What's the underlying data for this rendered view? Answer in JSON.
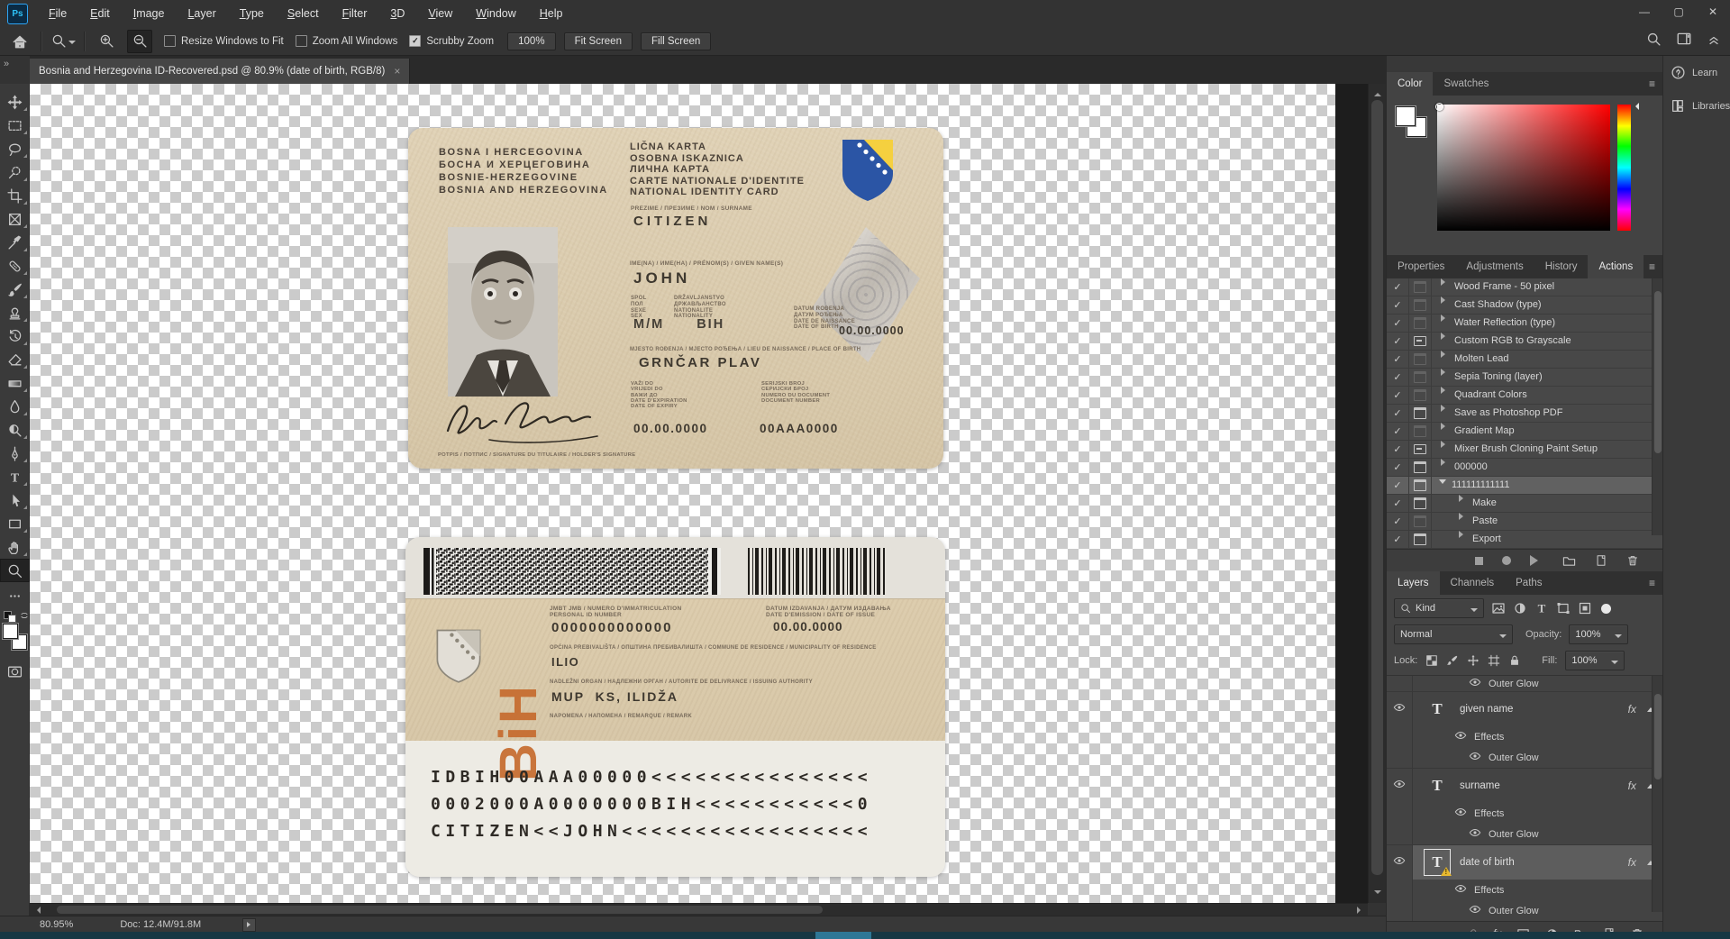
{
  "window": {
    "logo": "Ps",
    "menus": [
      "File",
      "Edit",
      "Image",
      "Layer",
      "Type",
      "Select",
      "Filter",
      "3D",
      "View",
      "Window",
      "Help"
    ],
    "controls": {
      "minimize": "—",
      "restore": "▢",
      "close": "✕"
    }
  },
  "options": {
    "resize_windows": "Resize Windows to Fit",
    "zoom_all_windows": "Zoom All Windows",
    "scrubby_zoom": "Scrubby Zoom",
    "zoom_level": "100%",
    "fit_screen": "Fit Screen",
    "fill_screen": "Fill Screen"
  },
  "tab": {
    "title": "Bosnia and Herzegovina ID-Recovered.psd @ 80.9% (date of birth, RGB/8)",
    "close": "×",
    "overflow": "»"
  },
  "front": {
    "country": [
      "BOSNA I HERCEGOVINA",
      "БОСНА И ХЕРЦЕГОВИНА",
      "BOSNIE-HERZEGOVINE",
      "BOSNIA AND HERZEGOVINA"
    ],
    "card_titles": [
      "LIČNA KARTA",
      "OSOBNA ISKAZNICA",
      "ЛИЧНА КАРТА",
      "CARTE NATIONALE D'IDENTITE",
      "NATIONAL IDENTITY CARD"
    ],
    "surname_label": "PREZIME / ПРЕЗИМЕ / NOM / SURNAME",
    "surname": "CITIZEN",
    "given_label": "IME(NA) / ИМЕ(НА) / PRÉNOM(S) / GIVEN NAME(S)",
    "given": "JOHN",
    "sex_labels": [
      "SPOL",
      "ПОЛ",
      "SEXE",
      "SEX"
    ],
    "nat_labels": [
      "DRŽAVLJANSTVO",
      "ДРЖАВЉАНСТВО",
      "NATIONALITE",
      "NATIONALITY"
    ],
    "dob_labels": [
      "DATUM ROĐENJA",
      "ДАТУМ РОЂЕЊА",
      "DATE DE NAISSANCE",
      "DATE OF BIRTH"
    ],
    "sex_value": "M/M",
    "nat_value": "BIH",
    "dob_value": "00.00.0000",
    "pob_label": "MJESTO ROĐENJA / МЈЕСТО РОЂЕЊА / LIEU DE NAISSANCE / PLACE OF BIRTH",
    "pob_value": "GRNČAR PLAV",
    "expiry_labels": [
      "VAŽI DO",
      "VRIJEDI DO",
      "ВАЖИ ДО",
      "DATE D'EXPIRATION",
      "DATE OF EXPIRY"
    ],
    "docnum_labels": [
      "SERIJSKI BROJ",
      "СЕРИЈСКИ БРОЈ",
      "NUMERO DU DOCUMENT",
      "DOCUMENT NUMBER"
    ],
    "expiry_value": "00.00.0000",
    "docnum_value": "00AAA0000",
    "signature_label": "POTPIS / ПОТПИС / SIGNATURE DU TITULAIRE / HOLDER'S SIGNATURE"
  },
  "back": {
    "pin_label1": "JMBT JMB / NUMERO D'IMMATRICULATION",
    "pin_label2": "PERSONAL ID NUMBER",
    "pin": "0000000000000",
    "issue_label1": "DATUM IZDAVANJA / ДАТУМ ИЗДАВАЊА",
    "issue_label2": "DATE D'EMISSION / DATE OF ISSUE",
    "issue": "00.00.0000",
    "residence_label": "OPĆINA PREBIVALIŠTA / ОПШТИНА ПРЕБИВАЛИШТА / COMMUNE DE RESIDENCE / MUNICIPALITY OF RESIDENCE",
    "residence": "ILIO",
    "authority_label": "NADLEŽNI ORGAN / НАДЛЕЖНИ ОРГАН / AUTORITE DE DELIVRANCE / ISSUING AUTHORITY",
    "authority": "MUP  KS, ILIDŽA",
    "remark_label": "NAPOMENA / НАПОМЕНА / REMARQUE / REMARK",
    "brand": "BiH",
    "mrz1": "IDBIH00AAA00000<<<<<<<<<<<<<<<",
    "mrz2": "0002000A0000000BIH<<<<<<<<<<<0",
    "mrz3": "CITIZEN<<JOHN<<<<<<<<<<<<<<<<<"
  },
  "panels": {
    "color_tabs": [
      "Color",
      "Swatches"
    ],
    "group_tabs": [
      "Properties",
      "Adjustments",
      "History",
      "Actions"
    ],
    "actions": [
      {
        "label": "Wood Frame - 50 pixel"
      },
      {
        "label": "Cast Shadow (type)"
      },
      {
        "label": "Water Reflection (type)"
      },
      {
        "label": "Custom RGB to Grayscale"
      },
      {
        "label": "Molten Lead"
      },
      {
        "label": "Sepia Toning (layer)"
      },
      {
        "label": "Quadrant Colors"
      },
      {
        "label": "Save as Photoshop PDF"
      },
      {
        "label": "Gradient Map"
      },
      {
        "label": "Mixer Brush Cloning Paint Setup"
      },
      {
        "label": "000000"
      },
      {
        "label": "111111111111"
      },
      {
        "label": "Make"
      },
      {
        "label": "Paste"
      },
      {
        "label": "Export"
      }
    ],
    "layers_tabs": [
      "Layers",
      "Channels",
      "Paths"
    ],
    "kind": "Kind",
    "blend_mode": "Normal",
    "opacity_label": "Opacity:",
    "opacity": "100%",
    "lock_label": "Lock:",
    "fill_label": "Fill:",
    "fill": "100%",
    "fx": "fx",
    "layer_rows": [
      {
        "label": "Outer Glow"
      },
      {
        "label": "given name"
      },
      {
        "label": "Effects"
      },
      {
        "label": "Outer Glow"
      },
      {
        "label": "surname"
      },
      {
        "label": "Effects"
      },
      {
        "label": "Outer Glow"
      },
      {
        "label": "date of birth"
      },
      {
        "label": "Effects"
      },
      {
        "label": "Outer Glow"
      }
    ],
    "learn": "Learn",
    "libraries": "Libraries"
  },
  "status": {
    "zoom": "80.95%",
    "doc": "Doc: 12.4M/91.8M"
  },
  "icons": {
    "check": "✓",
    "menu": "≡",
    "thumb_T": "T",
    "colors": {
      "accent_blue": "#2ec0f5",
      "warning_yellow": "#e8b92f",
      "bih_orange": "#c66a2e",
      "taskbar_teal": "#173743"
    }
  }
}
